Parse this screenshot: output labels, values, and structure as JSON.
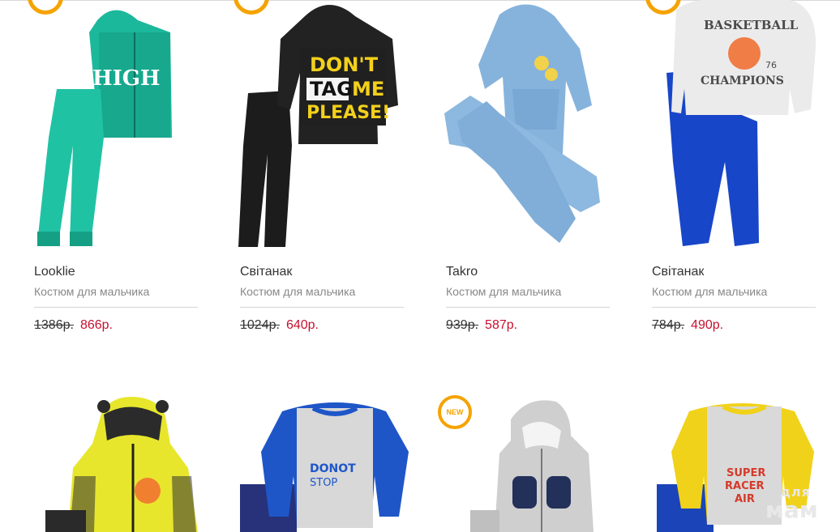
{
  "products_row1": [
    {
      "brand": "Looklie",
      "description": "Костюм для мальчика",
      "old_price": "1386р.",
      "new_price": "866р."
    },
    {
      "brand": "Світанак",
      "description": "Костюм для мальчика",
      "old_price": "1024р.",
      "new_price": "640р."
    },
    {
      "brand": "Takro",
      "description": "Костюм для мальчика",
      "old_price": "939р.",
      "new_price": "587р."
    },
    {
      "brand": "Світанак",
      "description": "Костюм для мальчика",
      "old_price": "784р.",
      "new_price": "490р."
    }
  ],
  "image_text": {
    "hoodie1": "HIGH",
    "hoodie2_line1": "DON'T",
    "hoodie2_line2": "TAG",
    "hoodie2_line3": "ME",
    "hoodie2_line4": "PLEASE!",
    "hoodie4_line1": "BASKETBALL",
    "hoodie4_line2": "CHAMPIONS",
    "hoodie4_num": "76",
    "shirt6_line1": "DONOT",
    "shirt6_line2": "STOP",
    "shirt8_line1": "SUPER",
    "shirt8_line2": "RACER",
    "shirt8_line3": "AIR"
  },
  "badges": {
    "new_label": "NEW"
  },
  "watermark": {
    "line1": "для",
    "line2": "мам"
  },
  "colors": {
    "price_new": "#c8102e",
    "badge": "#f5a300"
  }
}
